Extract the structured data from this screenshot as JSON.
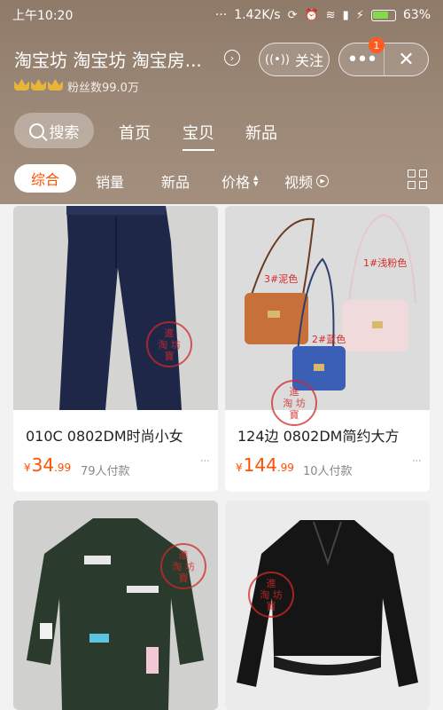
{
  "status_bar": {
    "time": "上午10:20",
    "dots": "···",
    "speed": "1.42K/s",
    "battery_pct": "63%"
  },
  "shop": {
    "name": "淘宝坊 淘宝坊 淘宝房...",
    "fans": "粉丝数99.0万",
    "follow_label": "关注",
    "more_badge": "1"
  },
  "nav": {
    "search_label": "搜索",
    "tabs": [
      {
        "label": "首页"
      },
      {
        "label": "宝贝"
      },
      {
        "label": "新品"
      }
    ]
  },
  "filters": {
    "all": "综合",
    "sales": "销量",
    "new": "新品",
    "price": "价格",
    "video": "视频"
  },
  "products": [
    {
      "title": "010C 0802DM时尚小女",
      "currency": "¥",
      "price_int": "34",
      "price_dec": ".99",
      "sold": "79人付款",
      "stamp": "進\n淘 坊\n寶"
    },
    {
      "title": "124边 0802DM简约大方",
      "currency": "¥",
      "price_int": "144",
      "price_dec": ".99",
      "sold": "10人付款",
      "stamp": "進\n淘 坊\n寶",
      "bag_labels": [
        "3#泥色",
        "1#浅粉色",
        "2#蓝色"
      ]
    },
    {
      "title": "",
      "stamp": "進\n淘 坊\n寶"
    },
    {
      "title": "",
      "stamp": "進\n淘 坊\n寶"
    }
  ],
  "colors": {
    "accent": "#ff5000",
    "header": "#9a8675"
  }
}
